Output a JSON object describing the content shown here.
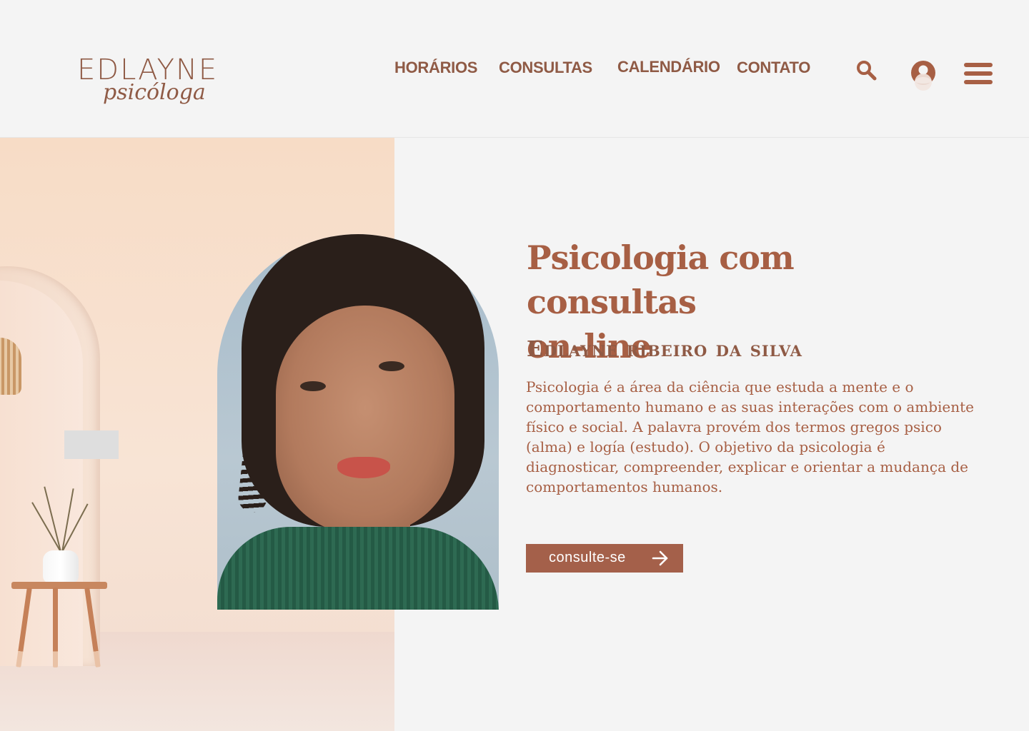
{
  "brand": {
    "name": "EDLAYNE",
    "subtitle": "psicóloga"
  },
  "nav": {
    "horarios": "HORÁRIOS",
    "consultas": "CONSULTAS",
    "calendario": "CALENDÁRIO",
    "contato": "CONTATO"
  },
  "icons": {
    "search": "search-icon",
    "account": "user-avatar-icon",
    "menu": "hamburger-menu-icon"
  },
  "hero": {
    "title_line1": "Psicologia com consultas",
    "title_line2": "on-line",
    "name": "Edlayne ribeiro da silva",
    "description": "Psicologia é a área da ciência que estuda a mente e o comportamento humano e as suas interações com o ambiente físico e social. A palavra provém dos termos gregos psico (alma) e logía (estudo). O objetivo da psicologia é diagnosticar, compreender, explicar e orientar a mudança de comportamentos humanos.",
    "cta_label": "consulte-se"
  },
  "colors": {
    "brand_brown": "#8f5a45",
    "accent_terracotta": "#a75f44",
    "button_bg": "#a4604a",
    "page_bg": "#f4f4f4",
    "peach_bg": "#f7dcc6"
  }
}
